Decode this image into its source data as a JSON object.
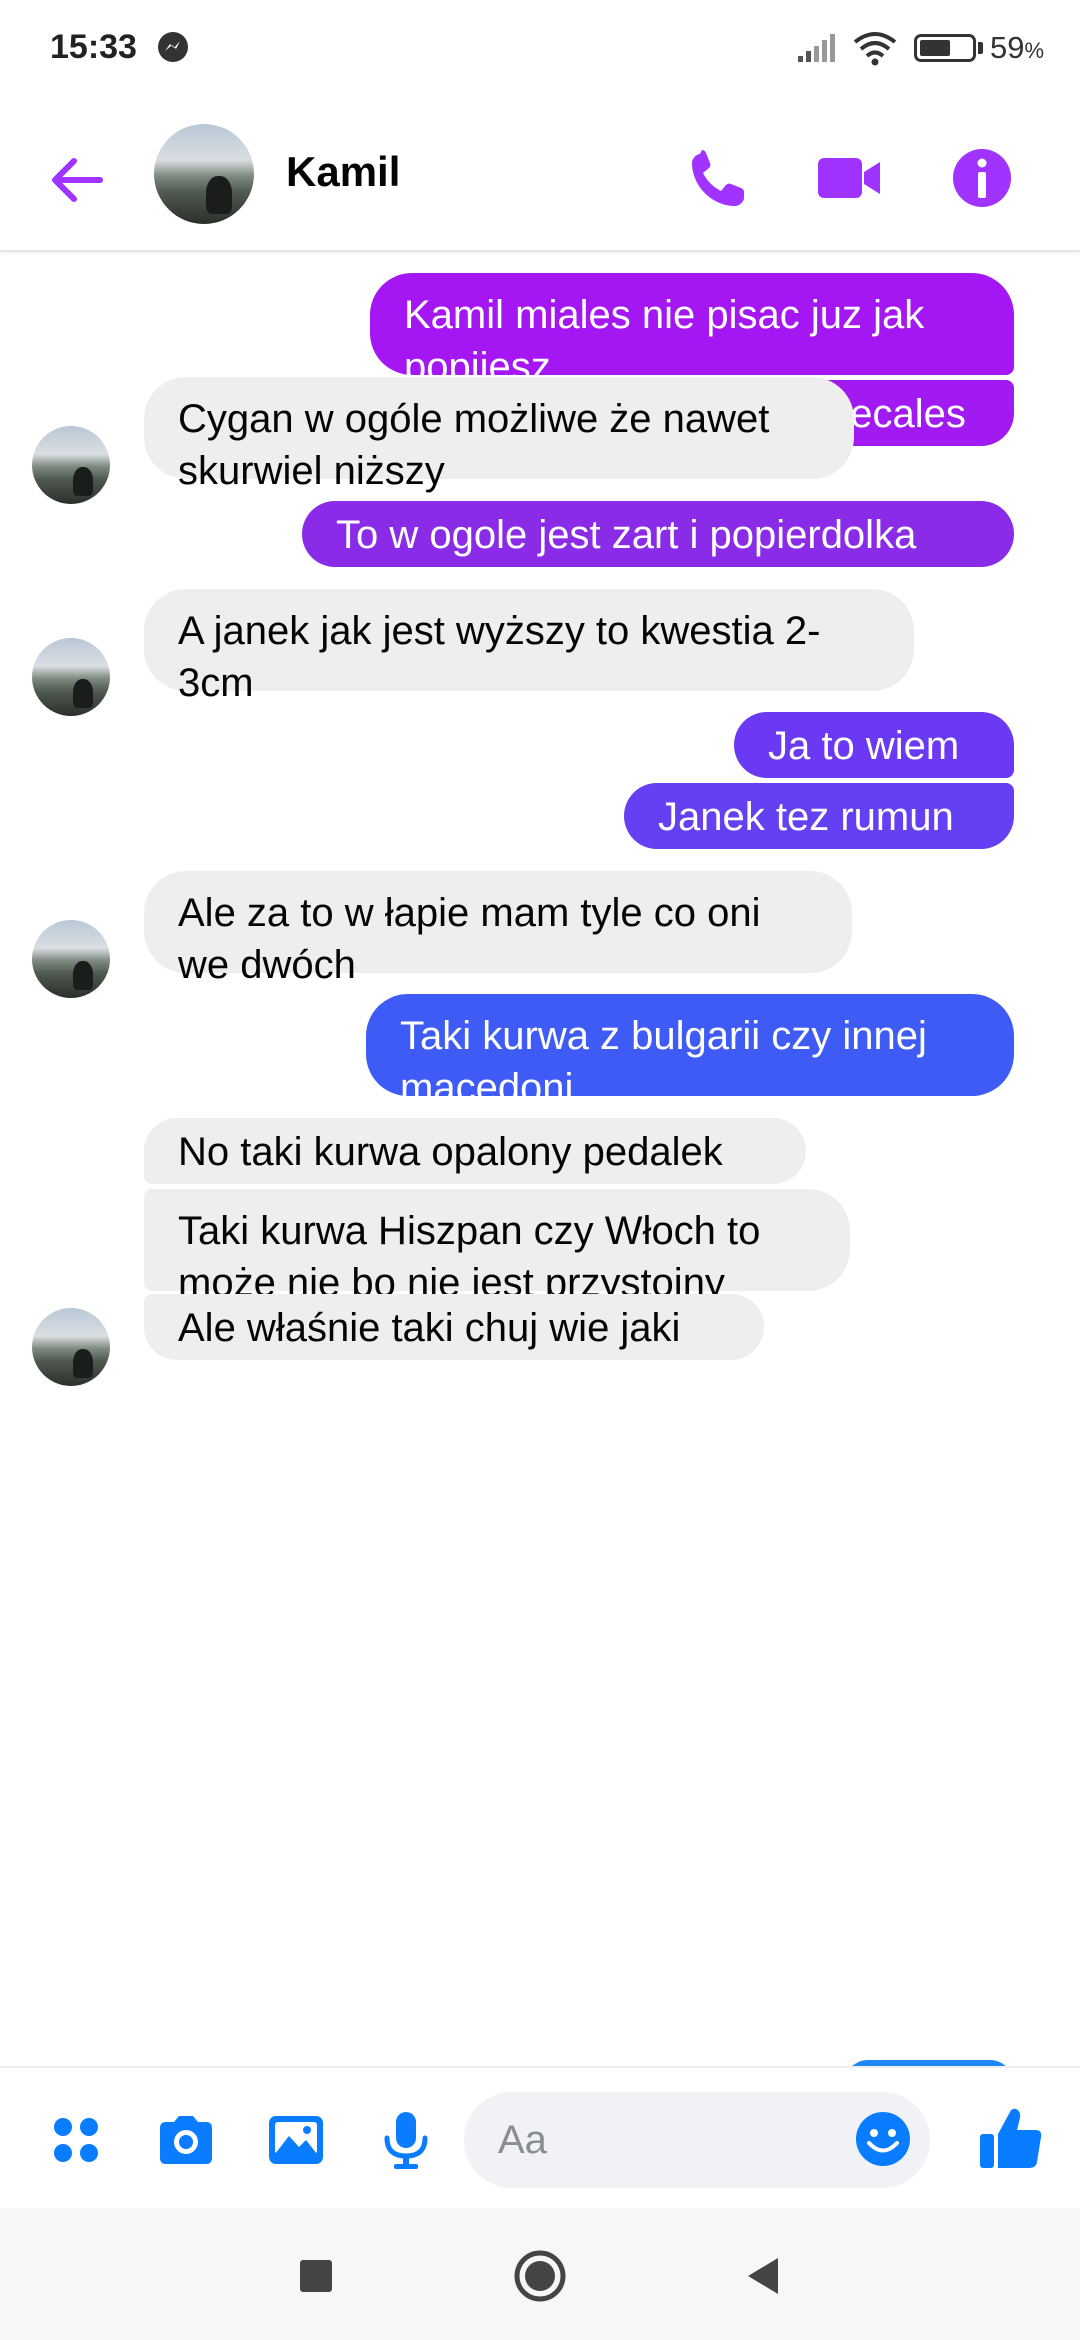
{
  "status_bar": {
    "time": "15:33",
    "battery_percent": "59",
    "battery_unit": "%",
    "battery_level": 0.59,
    "icons": [
      "messenger-notification-icon",
      "signal-icon",
      "wifi-icon",
      "battery-icon"
    ]
  },
  "header": {
    "contact_name": "Kamil",
    "icons": [
      "back-arrow-icon",
      "phone-icon",
      "video-camera-icon",
      "info-icon"
    ]
  },
  "colors": {
    "accent": "#A033FF",
    "outgoing_gradient": [
      "#A416F2",
      "#8A2BE8",
      "#6B38F3",
      "#3F5BF6",
      "#1E88F6"
    ],
    "incoming_bubble": "#EEEEEE",
    "composer_icons": "#0A7CFF"
  },
  "messages": [
    {
      "from": "me",
      "text": "Kamil miales nie pisac juz jak popijesz",
      "color": "#A416F2"
    },
    {
      "from": "me",
      "text": "Obiecales",
      "color": "#A11AF2"
    },
    {
      "from": "Kamil",
      "text": "Cygan w ogóle możliwe że nawet skurwiel niższy"
    },
    {
      "from": "me",
      "text": "To w ogole jest zart i popierdolka",
      "color": "#8A2BE8"
    },
    {
      "from": "Kamil",
      "text": "A janek jak jest wyższy to kwestia 2-3cm"
    },
    {
      "from": "me",
      "text": "Ja to wiem",
      "color": "#6B38F3"
    },
    {
      "from": "me",
      "text": "Janek tez rumun",
      "color": "#6440F2"
    },
    {
      "from": "Kamil",
      "text": "Ale za to w łapie mam tyle co oni we dwóch"
    },
    {
      "from": "me",
      "text": "Taki kurwa z bulgarii czy innej macedoni",
      "color": "#3F5BF6"
    },
    {
      "from": "Kamil",
      "text": "No taki kurwa opalony pedalek"
    },
    {
      "from": "Kamil",
      "text": "Taki kurwa Hiszpan czy Włoch to może nie bo nie jest przystojny"
    },
    {
      "from": "Kamil",
      "text": "Ale właśnie taki chuj wie jaki"
    }
  ],
  "composer": {
    "placeholder": "Aa",
    "icons": [
      "apps-grid-icon",
      "camera-icon",
      "gallery-icon",
      "microphone-icon",
      "emoji-icon",
      "thumbs-up-icon"
    ]
  },
  "nav_bar": {
    "icons": [
      "recents-square-icon",
      "home-circle-icon",
      "back-triangle-icon"
    ]
  }
}
